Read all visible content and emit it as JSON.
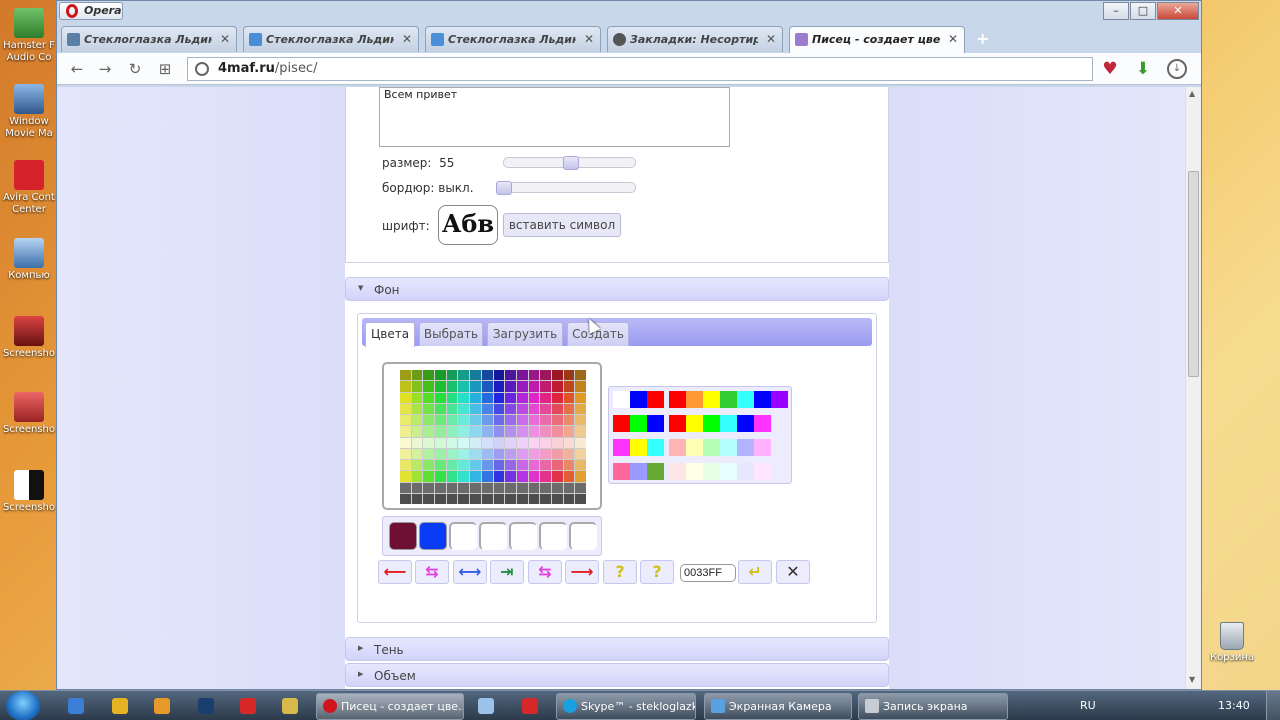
{
  "desktop": {
    "icons": [
      {
        "label": "Hamster F Audio Co"
      },
      {
        "label": "Window Movie Ma"
      },
      {
        "label": "Avira Cont Center"
      },
      {
        "label": "Компью"
      },
      {
        "label": "Screensho"
      },
      {
        "label": "Screensho"
      },
      {
        "label": "Screensho"
      }
    ],
    "recycle_label": "Корзина"
  },
  "browser": {
    "menu_button": "Opera",
    "tabs": [
      {
        "label": "Стеклоглазка Льдинка",
        "icon": "vk-icon"
      },
      {
        "label": "Стеклоглазка Льдинка",
        "icon": "vk-icon"
      },
      {
        "label": "Стеклоглазка Льдинка",
        "icon": "vk-icon"
      },
      {
        "label": "Закладки: Несортирован",
        "icon": "heart-icon"
      },
      {
        "label": "Писец - создает цвет",
        "icon": "site-icon"
      }
    ],
    "address": {
      "domain": "4maf.ru",
      "path": "/pisec/"
    }
  },
  "page": {
    "text_value": "Всем привет",
    "size_label": "размер:",
    "size_value": "55",
    "size_fraction": 0.51,
    "border_label": "бордюр:",
    "border_value": "выкл.",
    "border_fraction": 0.0,
    "font_label": "шрифт:",
    "font_preview": "Абв",
    "insert_symbol": "вставить символ",
    "section_background": "Фон",
    "tabs": [
      "Цвета",
      "Выбрать",
      "Загрузить",
      "Создать"
    ],
    "hex_value": "0033FF",
    "section_shadow": "Тень",
    "section_volume": "Объем",
    "recent_colors": [
      "#6e1034",
      "#0a3cf5"
    ],
    "quick_colors": [
      "#ffffff",
      "#0000ff",
      "#ff0000",
      "#ff0000",
      "#ff9933",
      "#ffff00",
      "#33cc33",
      "#33ffff",
      "#0000ff",
      "#9900ff",
      "#ff0000",
      "#00ff00",
      "#0000ff",
      "#ff0000",
      "#ffff00",
      "#00ff00",
      "#33ffff",
      "#0000ff",
      "#ff33ff",
      "#ff33ff",
      "#ffff00",
      "#33ffff",
      "#ffb3b3",
      "#ffffb3",
      "#b3ffb3",
      "#b3ffff",
      "#b3b3ff",
      "#ffb3ff",
      "#ff6699",
      "#9999ff",
      "#66aa33",
      "#ffe6e6",
      "#ffffe6",
      "#e6ffe6",
      "#e6ffff",
      "#e6e6ff",
      "#ffe6ff"
    ]
  },
  "taskbar": {
    "tasks": [
      {
        "label": "Писец - создает цве..."
      },
      {
        "label": "Skype™ - stekloglazk..."
      },
      {
        "label": "Экранная Камера"
      },
      {
        "label": "Запись экрана"
      }
    ],
    "lang": "RU",
    "clock": "13:40"
  }
}
